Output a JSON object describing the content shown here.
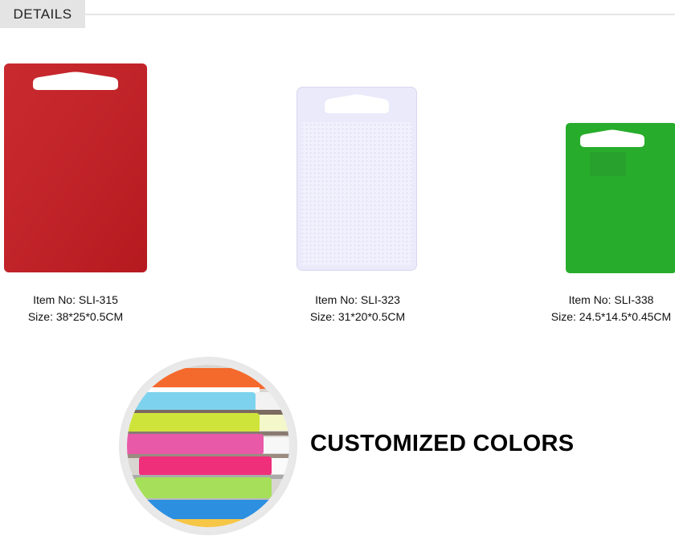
{
  "header": {
    "tab_label": "DETAILS"
  },
  "products": [
    {
      "item_label": "Item No: SLI-315",
      "size_label": "Size:  38*25*0.5CM",
      "color": "#c51c22",
      "color_name": "red"
    },
    {
      "item_label": "Item No: SLI-323",
      "size_label": "Size:  31*20*0.5CM",
      "color": "#eeeefc",
      "color_name": "white"
    },
    {
      "item_label": "Item No: SLI-338",
      "size_label": "Size:  24.5*14.5*0.45CM",
      "color": "#27ad2b",
      "color_name": "green"
    }
  ],
  "feature": {
    "title": "CUSTOMIZED COLORS",
    "stack_colors": [
      "#f46a2c",
      "#7dd3ee",
      "#cfe43a",
      "#e85aa8",
      "#ef2f7a",
      "#a6e05a",
      "#2c8fe0",
      "#f6c646"
    ]
  }
}
